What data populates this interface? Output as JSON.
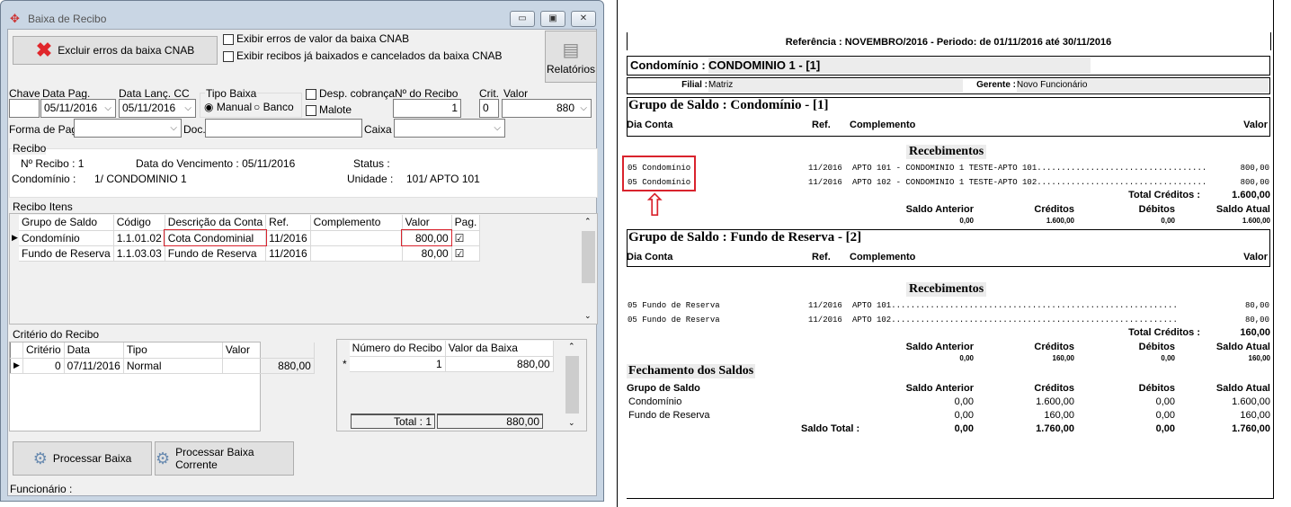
{
  "window": {
    "title": "Baixa de Recibo",
    "minimize": "▭",
    "maximize": "▣",
    "close": "✕"
  },
  "toolbar": {
    "excluir_label": "Excluir erros da baixa CNAB",
    "chk_erros": "Exibir erros de valor da baixa CNAB",
    "chk_recibos": "Exibir recibos já baixados e cancelados da baixa CNAB",
    "relatorios_label": "Relatórios"
  },
  "filters": {
    "chave_label": "Chave",
    "chave_value": "",
    "data_pag_label": "Data Pag.",
    "data_pag_value": "05/11/2016",
    "data_lanc_label": "Data Lanç. CC",
    "data_lanc_value": "05/11/2016",
    "tipo_baixa_label": "Tipo Baixa",
    "radio_manual": "Manual",
    "radio_banco": "Banco",
    "tipo_baixa_selected": "Manual",
    "desp_cobranca": "Desp. cobrança",
    "malote": "Malote",
    "num_recibo_label": "Nº do Recibo",
    "num_recibo_value": "1",
    "crit_label": "Crit.",
    "crit_value": "0",
    "valor_label": "Valor",
    "valor_value": "880",
    "forma_pag_label": "Forma de Pag.",
    "forma_pag_value": "",
    "doc_label": "Doc.",
    "doc_value": "",
    "caixa_label": "Caixa",
    "caixa_value": ""
  },
  "recibo": {
    "legend": "Recibo",
    "num": "Nº Recibo : 1",
    "vencimento": "Data do Vencimento : 05/11/2016",
    "status": "Status :",
    "condominio_label": "Condomínio :",
    "condominio_value": "1/  CONDOMINIO 1",
    "unidade_label": "Unidade :",
    "unidade_value": "101/  APTO 101"
  },
  "itens": {
    "legend": "Recibo Itens",
    "columns": [
      "Grupo de Saldo",
      "Código",
      "Descrição da Conta",
      "Ref.",
      "Complemento",
      "Valor",
      "Pag."
    ],
    "rows": [
      [
        "Condomínio",
        "1.1.01.02",
        "Cota Condominial",
        "11/2016",
        "",
        "800,00",
        true
      ],
      [
        "Fundo de Reserva",
        "1.1.03.03",
        "Fundo de Reserva",
        "11/2016",
        "",
        "80,00",
        true
      ]
    ]
  },
  "criterio": {
    "legend": "Critério do Recibo",
    "columns": [
      "Critério",
      "Data",
      "Tipo",
      "Valor"
    ],
    "rows": [
      [
        "0",
        "07/11/2016",
        "Normal",
        "880,00"
      ]
    ],
    "baixa_columns": [
      "Número do Recibo",
      "Valor da Baixa"
    ],
    "baixa_rows": [
      [
        "*",
        "1",
        "880,00"
      ]
    ],
    "total_label": "Total : 1",
    "total_value": "880,00"
  },
  "actions": {
    "processar": "Processar Baixa",
    "processar_corrente": "Processar Baixa Corrente",
    "funcionario": "Funcionário :"
  },
  "report": {
    "referencia": "Referência : NOVEMBRO/2016 -  Periodo: de 01/11/2016 até 30/11/2016",
    "condominio_label": "Condomínio :",
    "condominio_value": "CONDOMINIO 1 - [1]",
    "filial_label": "Filial :",
    "filial_value": "Matriz",
    "gerente_label": "Gerente :",
    "gerente_value": "Novo Funcionário",
    "col_dia_conta": "Dia Conta",
    "col_ref": "Ref.",
    "col_complemento": "Complemento",
    "col_valor": "Valor",
    "recebimentos": "Recebimentos",
    "total_creditos": "Total Créditos :",
    "saldo_headers": [
      "Saldo Anterior",
      "Créditos",
      "Débitos",
      "Saldo Atual"
    ],
    "groups": [
      {
        "title": "Grupo de Saldo : Condomínio - [1]",
        "rows": [
          [
            "05 Condomínio",
            "11/2016",
            "APTO 101 - CONDOMINIO 1 TESTE-APTO 101...................................",
            "800,00"
          ],
          [
            "05 Condomínio",
            "11/2016",
            "APTO 102 - CONDOMINIO 1 TESTE-APTO 102...................................",
            "800,00"
          ]
        ],
        "total": "1.600,00",
        "saldos": [
          "0,00",
          "1.600,00",
          "0,00",
          "1.600,00"
        ]
      },
      {
        "title": "Grupo de Saldo : Fundo de Reserva - [2]",
        "rows": [
          [
            "05 Fundo de Reserva",
            "11/2016",
            "APTO 101...........................................................",
            "80,00"
          ],
          [
            "05 Fundo de Reserva",
            "11/2016",
            "APTO 102...........................................................",
            "80,00"
          ]
        ],
        "total": "160,00",
        "saldos": [
          "0,00",
          "160,00",
          "0,00",
          "160,00"
        ]
      }
    ],
    "fechamento": {
      "title": "Fechamento dos Saldos",
      "grupo_label": "Grupo de Saldo",
      "rows": [
        [
          "Condomínio",
          "0,00",
          "1.600,00",
          "0,00",
          "1.600,00"
        ],
        [
          "Fundo de Reserva",
          "0,00",
          "160,00",
          "0,00",
          "160,00"
        ]
      ],
      "total_label": "Saldo Total :",
      "totals": [
        "0,00",
        "1.760,00",
        "0,00",
        "1.760,00"
      ]
    }
  },
  "colors": {
    "highlight": "#d9232d",
    "title_bar": "#c9d6e4"
  }
}
